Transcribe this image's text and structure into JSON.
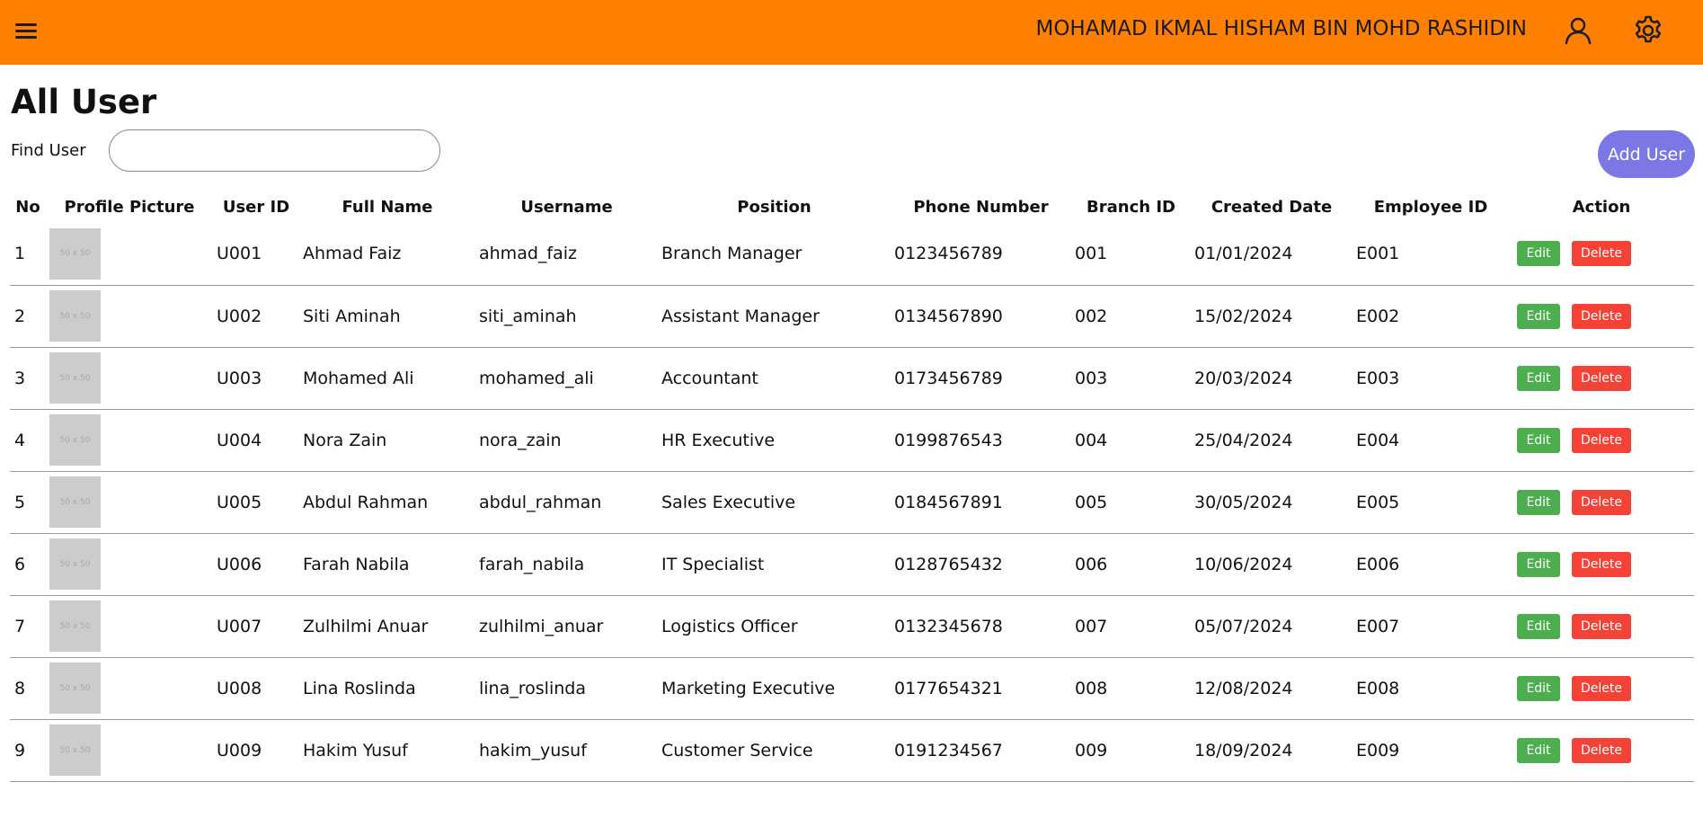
{
  "header": {
    "user_name": "MOHAMAD IKMAL HISHAM BIN MOHD RASHIDIN",
    "icons": [
      "menu-icon",
      "user-icon",
      "gear-icon"
    ],
    "background_color": "#ff8000"
  },
  "page": {
    "title": "All User",
    "find_label": "Find User",
    "search_value": "",
    "add_user_label": "Add User"
  },
  "table": {
    "columns": [
      "No",
      "Profile Picture",
      "User ID",
      "Full Name",
      "Username",
      "Position",
      "Phone Number",
      "Branch ID",
      "Created Date",
      "Employee ID",
      "Action"
    ],
    "thumb_text": "50 x 50",
    "edit_label": "Edit",
    "delete_label": "Delete",
    "rows": [
      {
        "no": "1",
        "user_id": "U001",
        "full_name": "Ahmad Faiz",
        "username": "ahmad_faiz",
        "position": "Branch Manager",
        "phone": "0123456789",
        "branch_id": "001",
        "created": "01/01/2024",
        "employee_id": "E001"
      },
      {
        "no": "2",
        "user_id": "U002",
        "full_name": "Siti Aminah",
        "username": "siti_aminah",
        "position": "Assistant Manager",
        "phone": "0134567890",
        "branch_id": "002",
        "created": "15/02/2024",
        "employee_id": "E002"
      },
      {
        "no": "3",
        "user_id": "U003",
        "full_name": "Mohamed Ali",
        "username": "mohamed_ali",
        "position": "Accountant",
        "phone": "0173456789",
        "branch_id": "003",
        "created": "20/03/2024",
        "employee_id": "E003"
      },
      {
        "no": "4",
        "user_id": "U004",
        "full_name": "Nora Zain",
        "username": "nora_zain",
        "position": "HR Executive",
        "phone": "0199876543",
        "branch_id": "004",
        "created": "25/04/2024",
        "employee_id": "E004"
      },
      {
        "no": "5",
        "user_id": "U005",
        "full_name": "Abdul Rahman",
        "username": "abdul_rahman",
        "position": "Sales Executive",
        "phone": "0184567891",
        "branch_id": "005",
        "created": "30/05/2024",
        "employee_id": "E005"
      },
      {
        "no": "6",
        "user_id": "U006",
        "full_name": "Farah Nabila",
        "username": "farah_nabila",
        "position": "IT Specialist",
        "phone": "0128765432",
        "branch_id": "006",
        "created": "10/06/2024",
        "employee_id": "E006"
      },
      {
        "no": "7",
        "user_id": "U007",
        "full_name": "Zulhilmi Anuar",
        "username": "zulhilmi_anuar",
        "position": "Logistics Officer",
        "phone": "0132345678",
        "branch_id": "007",
        "created": "05/07/2024",
        "employee_id": "E007"
      },
      {
        "no": "8",
        "user_id": "U008",
        "full_name": "Lina Roslinda",
        "username": "lina_roslinda",
        "position": "Marketing Executive",
        "phone": "0177654321",
        "branch_id": "008",
        "created": "12/08/2024",
        "employee_id": "E008"
      },
      {
        "no": "9",
        "user_id": "U009",
        "full_name": "Hakim Yusuf",
        "username": "hakim_yusuf",
        "position": "Customer Service",
        "phone": "0191234567",
        "branch_id": "009",
        "created": "18/09/2024",
        "employee_id": "E009"
      }
    ]
  }
}
